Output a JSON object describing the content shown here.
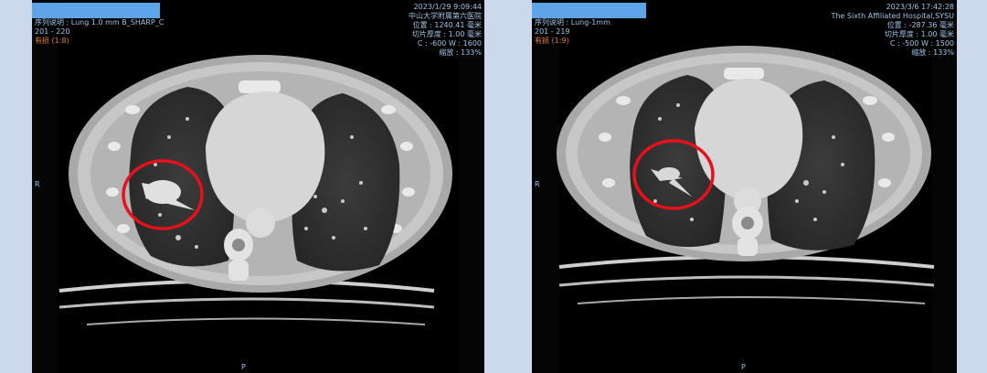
{
  "left_panel": {
    "series_desc": "序列说明 : Lung 1.0 mm B_SHARP_C",
    "range": "201 - 220",
    "status": "有损 (1:8)",
    "datetime": "2023/1/29 9:09:44",
    "institution": "中山大学附属第六医院",
    "position": "位置 : 1240.41 毫米",
    "thickness": "切片厚度 : 1.00 毫米",
    "window": "C : -600 W : 1600",
    "zoom": "缩放 : 133%",
    "orient_right": "R",
    "orient_bottom": "P"
  },
  "right_panel": {
    "series_desc": "序列说明 : Lung-1mm",
    "range": "201 - 219",
    "status": "有损 (1:9)",
    "datetime": "2023/3/6 17:42:28",
    "institution": "The Sixth Affiliated Hospital,SYSU",
    "position": "位置 : -287.36 毫米",
    "thickness": "切片厚度 : 1.00 毫米",
    "window": "C : -500 W : 1500",
    "zoom": "缩放 : 133%",
    "orient_right": "R",
    "orient_bottom": "P"
  },
  "colors": {
    "overlay_text": "#9ec3e6",
    "status_text": "#e07a2a",
    "annotation": "#e8101a",
    "redaction": "#5ea4e8",
    "page_bg": "#ccd9ec"
  }
}
